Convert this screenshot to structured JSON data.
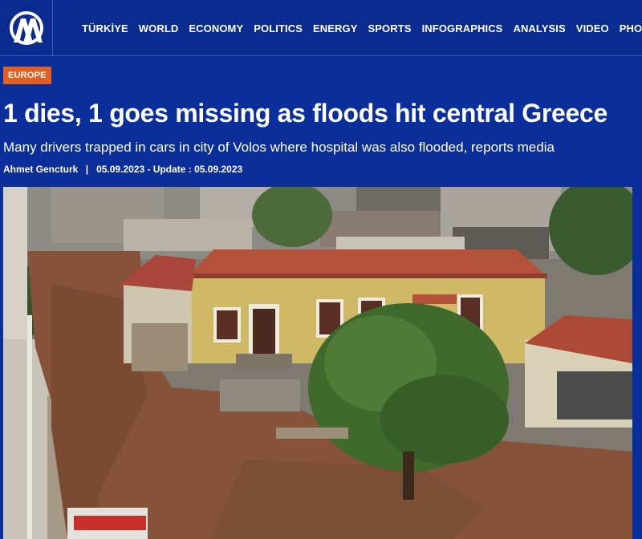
{
  "nav": {
    "logo": "AA",
    "items": [
      "TÜRKİYE",
      "WORLD",
      "ECONOMY",
      "POLITICS",
      "ENERGY",
      "SPORTS",
      "INFOGRAPHICS",
      "ANALYSIS",
      "VIDEO",
      "PHOTO"
    ]
  },
  "article": {
    "category": "EUROPE",
    "title": "1 dies, 1 goes missing as floods hit central Greece",
    "subtitle": "Many drivers trapped in cars in city of Volos where hospital was also flooded, reports media",
    "author": "Ahmet Gencturk",
    "separator": "|",
    "date_line": "05.09.2023 - Update : 05.09.2023"
  },
  "colors": {
    "brand_blue": "#0b2f9a",
    "badge_orange": "#e35f1f"
  }
}
